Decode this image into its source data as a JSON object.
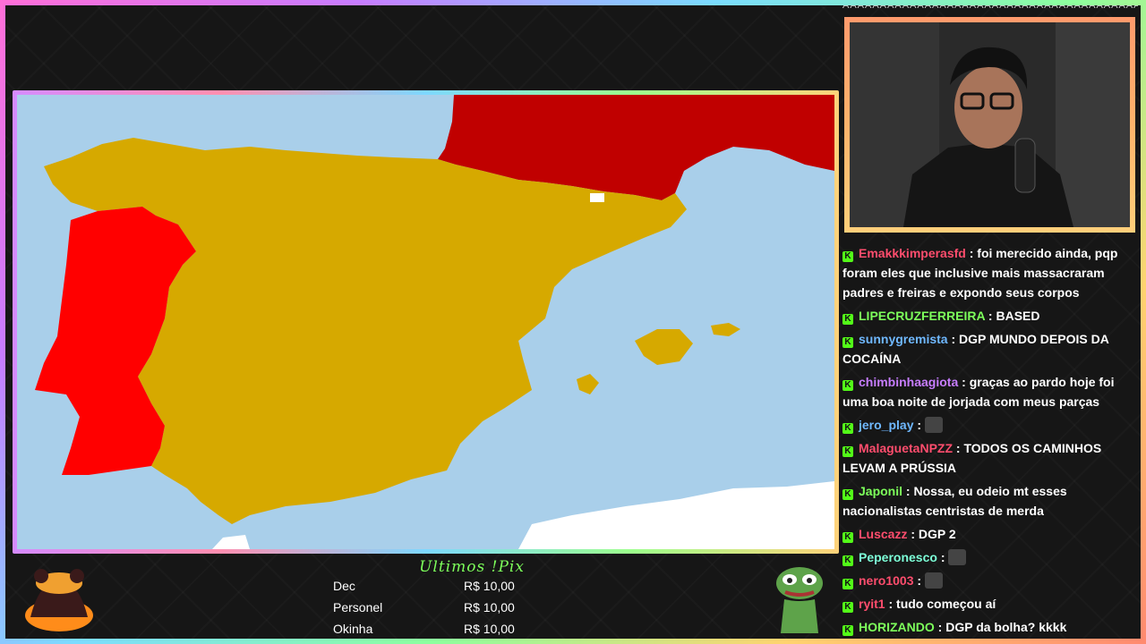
{
  "chat_top": "AAAAAAAAAAAAAAAAAAAAAAAAAAAAAAAAAAAAAAAAAAAAA",
  "chat": [
    {
      "user": "Emakkkimperasfd",
      "color": "#ff4d6d",
      "text": "foi merecido ainda, pqp foram eles que inclusive mais massacraram padres e freiras e expondo seus corpos"
    },
    {
      "user": "LIPECRUZFERREIRA",
      "color": "#7dff5b",
      "text": "BASED"
    },
    {
      "user": "sunnygremista",
      "color": "#6fb8ff",
      "text": "DGP MUNDO DEPOIS DA COCAÍNA"
    },
    {
      "user": "chimbinhaagiota",
      "color": "#c77dff",
      "text": "graças ao pardo hoje foi uma boa noite de jorjada com meus parças"
    },
    {
      "user": "jero_play",
      "color": "#6fb8ff",
      "text": ""
    },
    {
      "user": "MalaguetaNPZZ",
      "color": "#ff4d6d",
      "text": "TODOS OS CAMINHOS LEVAM A PRÚSSIA"
    },
    {
      "user": "Japonil",
      "color": "#7dff5b",
      "text": "Nossa, eu odeio mt esses nacionalistas centristas de merda"
    },
    {
      "user": "Luscazz",
      "color": "#ff4d6d",
      "text": "DGP 2"
    },
    {
      "user": "Peperonesco",
      "color": "#7dffd8",
      "text": ""
    },
    {
      "user": "nero1003",
      "color": "#ff4d6d",
      "text": ""
    },
    {
      "user": "ryit1",
      "color": "#ff4d6d",
      "text": "tudo começou aí"
    },
    {
      "user": "HORIZANDO",
      "color": "#7dff5b",
      "text": "DGP da bolha? kkkk"
    }
  ],
  "pix": {
    "title": "Ultimos !Pix",
    "rows": [
      {
        "name": "Dec",
        "amount": "R$ 10,00"
      },
      {
        "name": "Personel",
        "amount": "R$ 10,00"
      },
      {
        "name": "Okinha",
        "amount": "R$ 10,00"
      }
    ]
  },
  "map_colors": {
    "sea": "#a9cfea",
    "spain": "#d6a900",
    "portugal": "#ff0000",
    "france": "#c00000",
    "africa": "#ffffff"
  }
}
